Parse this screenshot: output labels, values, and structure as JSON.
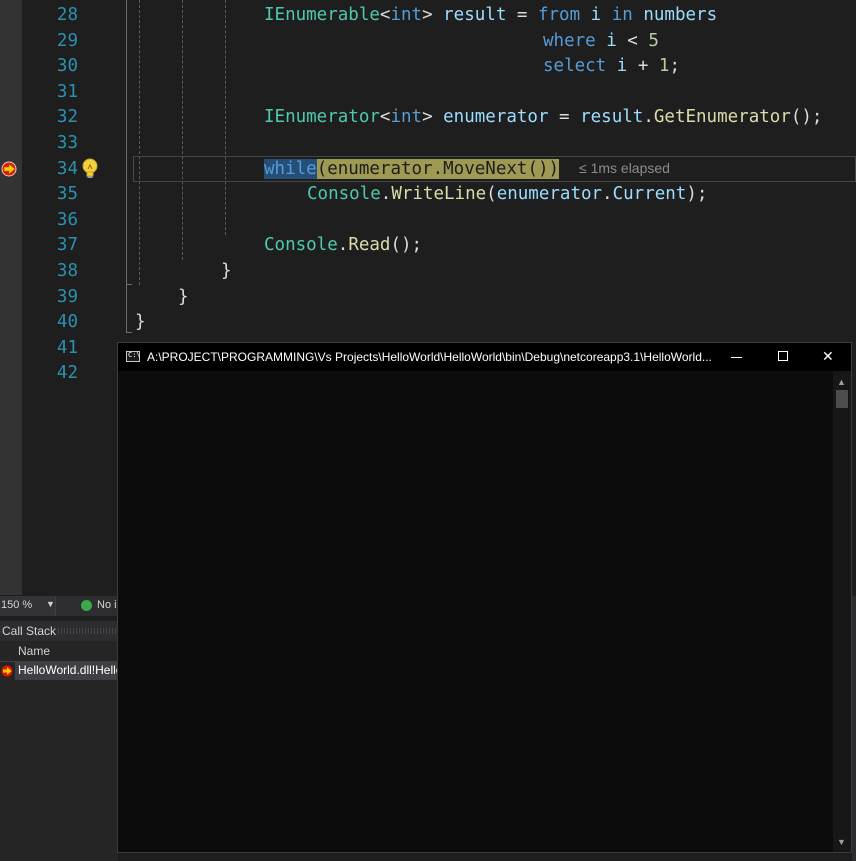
{
  "editor": {
    "line_numbers": [
      "28",
      "29",
      "30",
      "31",
      "32",
      "33",
      "34",
      "35",
      "36",
      "37",
      "38",
      "39",
      "40",
      "41",
      "42"
    ],
    "lines": {
      "l28": {
        "t1": "IEnumerable",
        "t2": "<",
        "t3": "int",
        "t4": "> ",
        "t5": "result",
        "t6": " = ",
        "t7": "from",
        "t8": " i ",
        "t9": "in",
        "t10": " numbers"
      },
      "l29": {
        "t1": "where",
        "t2": " i ",
        "t3": "<",
        "t4": " ",
        "t5": "5"
      },
      "l30": {
        "t1": "select",
        "t2": " i ",
        "t3": "+",
        "t4": " ",
        "t5": "1",
        "t6": ";"
      },
      "l32": {
        "t1": "IEnumerator",
        "t2": "<",
        "t3": "int",
        "t4": "> ",
        "t5": "enumerator",
        "t6": " = ",
        "t7": "result",
        "t8": ".",
        "t9": "GetEnumerator",
        "t10": "();"
      },
      "l34": {
        "t1": "while",
        "t2": "(",
        "t3": "enumerator",
        "t4": ".",
        "t5": "MoveNext",
        "t6": "())"
      },
      "l35": {
        "t1": "Console",
        "t2": ".",
        "t3": "WriteLine",
        "t4": "(",
        "t5": "enumerator",
        "t6": ".",
        "t7": "Current",
        "t8": ");"
      },
      "l37": {
        "t1": "Console",
        "t2": ".",
        "t3": "Read",
        "t4": "();"
      },
      "l38": {
        "t1": "}"
      },
      "l39": {
        "t1": "}"
      },
      "l40": {
        "t1": "}"
      }
    },
    "elapsed": "≤ 1ms elapsed"
  },
  "status": {
    "zoom": "150 %",
    "issues": "No i"
  },
  "call_stack": {
    "title": "Call Stack",
    "column_name": "Name",
    "row": "HelloWorld.dll!HelloWorld.Program.Main"
  },
  "console": {
    "title": "A:\\PROJECT\\PROGRAMMING\\Vs Projects\\HelloWorld\\HelloWorld\\bin\\Debug\\netcoreapp3.1\\HelloWorld...",
    "icon_text": "C:\\",
    "close_glyph": "✕",
    "scroll_up": "▲",
    "scroll_down": "▼"
  },
  "colors": {
    "keyword": "#569cd6",
    "type": "#4ec9b0",
    "identifier": "#9cdcfe",
    "method": "#dcdcaa",
    "number": "#b5cea8",
    "line_number": "#2b91af"
  }
}
